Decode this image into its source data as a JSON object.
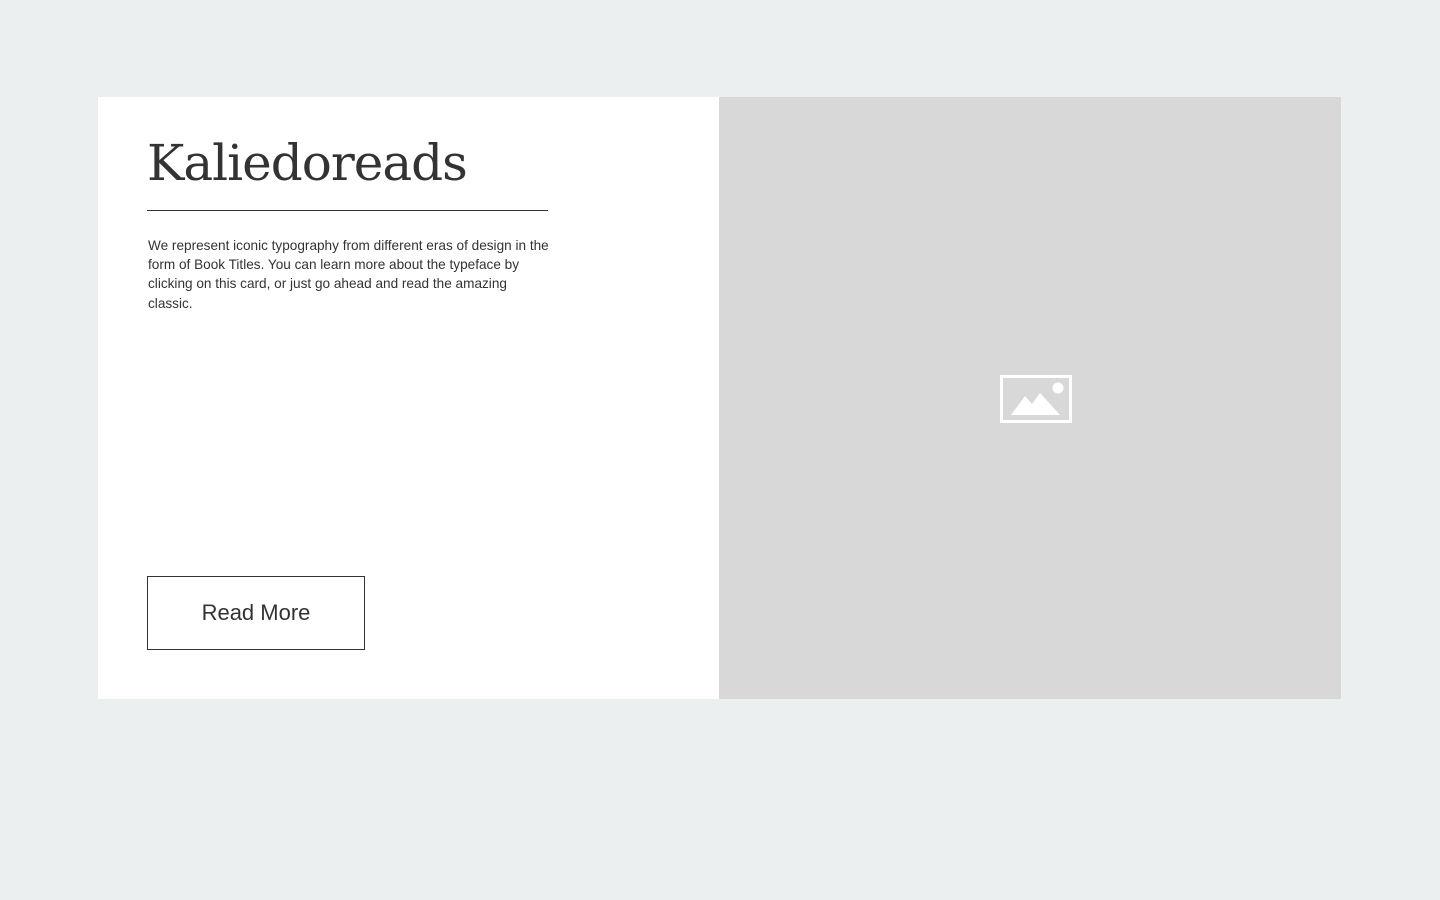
{
  "card": {
    "title": "Kaliedoreads",
    "description": "We represent iconic typography from different eras of design in the form of Book Titles. You can learn more about the typeface by clicking on this card, or just go ahead and read the amazing classic.",
    "button_label": "Read More",
    "image": {
      "icon": "image-placeholder-icon"
    }
  },
  "colors": {
    "page_background": "#ebeff0",
    "card_background": "#ffffff",
    "image_background": "#d8d8d8",
    "text": "#333333",
    "icon": "#ffffff"
  }
}
